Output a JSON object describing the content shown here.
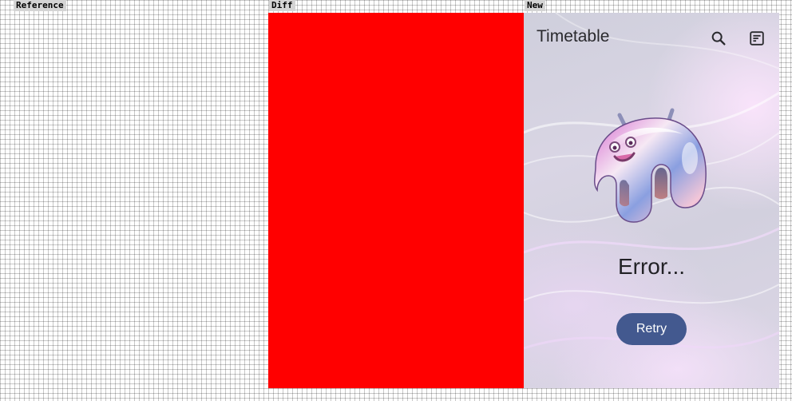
{
  "labels": {
    "reference": "Reference",
    "diff": "Diff",
    "new": "New"
  },
  "colors": {
    "diff_fill": "#ff0000",
    "button_bg": "#43598f",
    "button_text": "#ffffff",
    "title_text": "#2a2a2e"
  },
  "app": {
    "title": "Timetable",
    "actions": [
      {
        "icon": "search-icon"
      },
      {
        "icon": "timetable-icon"
      }
    ]
  },
  "error": {
    "message": "Error...",
    "retry_label": "Retry"
  }
}
